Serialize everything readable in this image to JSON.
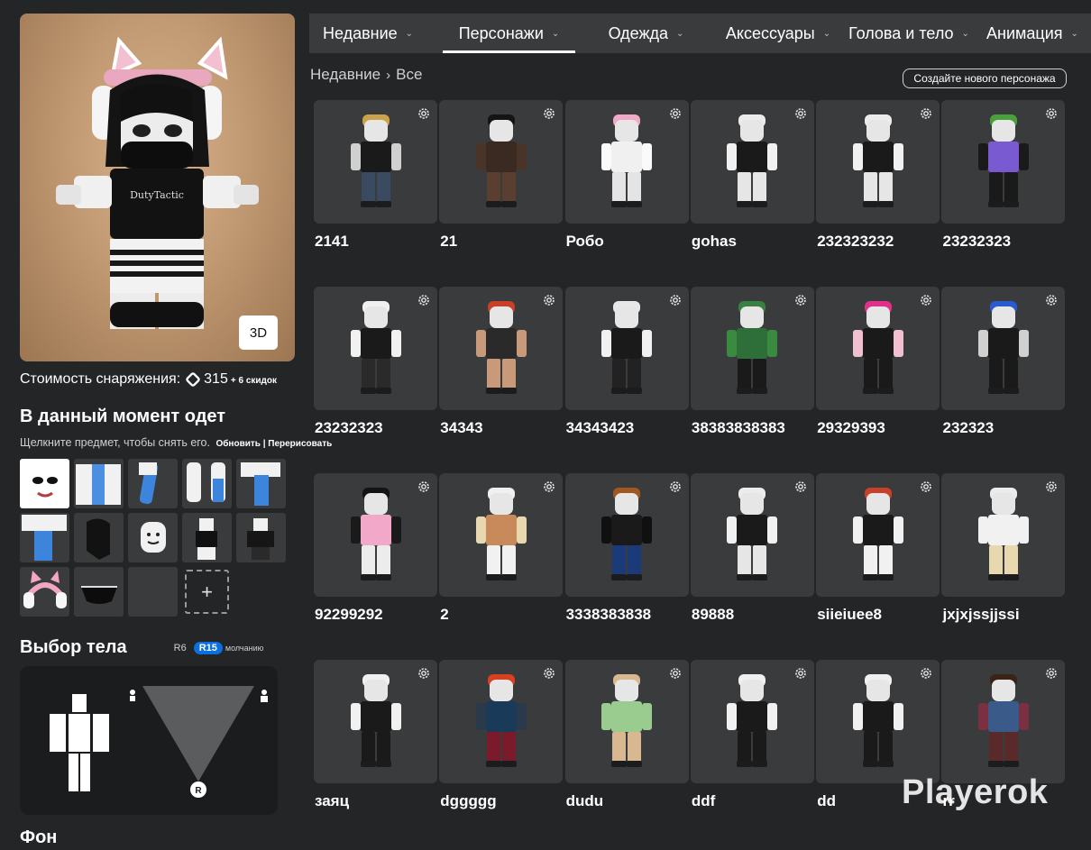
{
  "tabs": [
    {
      "label": "Недавние"
    },
    {
      "label": "Персонажи"
    },
    {
      "label": "Одежда"
    },
    {
      "label": "Аксессуары"
    },
    {
      "label": "Голова и тело"
    },
    {
      "label": "Анимация"
    }
  ],
  "active_tab": "Персонажи",
  "breadcrumb": {
    "parent": "Недавние",
    "current": "Все"
  },
  "create_outfit_label": "Создайте нового персонажа",
  "avatar": {
    "view_3d_label": "3D"
  },
  "cost": {
    "label": "Стоимость снаряжения:",
    "value": "315",
    "discounts": "+ 6 скидок"
  },
  "worn": {
    "title": "В данный момент одет",
    "hint": "Щелкните предмет, чтобы снять его.",
    "refresh": "Обновить | Перерисовать",
    "add_label": "+"
  },
  "body": {
    "title": "Выбор тела",
    "r6": "R6",
    "r15": "R15",
    "default": "молчанию"
  },
  "background_title": "Фон",
  "watermark": "Playerok",
  "outfits": [
    {
      "name": "2141"
    },
    {
      "name": "21"
    },
    {
      "name": "Робо"
    },
    {
      "name": "gohas"
    },
    {
      "name": "232323232"
    },
    {
      "name": "23232323"
    },
    {
      "name": "23232323"
    },
    {
      "name": "34343"
    },
    {
      "name": "34343423"
    },
    {
      "name": "38383838383"
    },
    {
      "name": "29329393"
    },
    {
      "name": "232323"
    },
    {
      "name": "92299292"
    },
    {
      "name": "2"
    },
    {
      "name": "3338383838"
    },
    {
      "name": "89888"
    },
    {
      "name": "siieiuee8"
    },
    {
      "name": "jxjxjssjjssi"
    },
    {
      "name": "заяц"
    },
    {
      "name": "dggggg"
    },
    {
      "name": "dudu"
    },
    {
      "name": "ddf"
    },
    {
      "name": "dd"
    },
    {
      "name": "rr"
    }
  ],
  "colors": {
    "bg": "#232527",
    "panel": "#393b3d",
    "accent": "#0a6fe0"
  }
}
